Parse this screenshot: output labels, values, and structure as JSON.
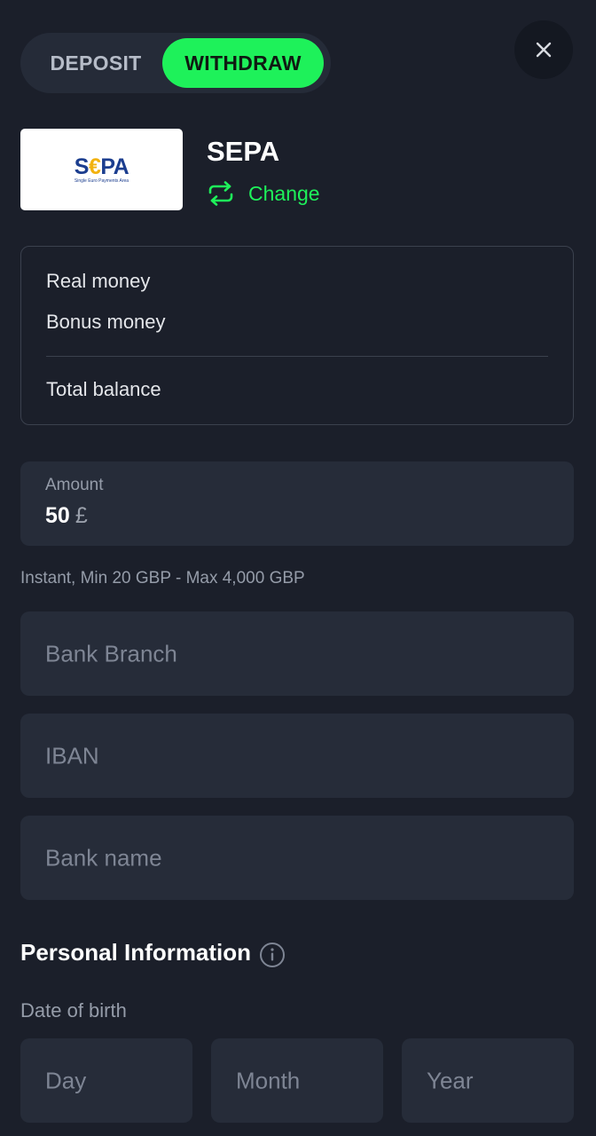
{
  "tabs": {
    "deposit": "DEPOSIT",
    "withdraw": "WITHDRAW"
  },
  "payment_method": {
    "logo_text_s": "S",
    "logo_text_euro": "€",
    "logo_text_pa": "PA",
    "logo_subtitle": "Single Euro Payments Area",
    "name": "SEPA",
    "change_label": "Change"
  },
  "balance": {
    "real_money": "Real money",
    "bonus_money": "Bonus money",
    "total_balance": "Total balance"
  },
  "amount": {
    "label": "Amount",
    "value": "50",
    "currency": "£"
  },
  "limits_text": "Instant, Min 20 GBP - Max 4,000 GBP",
  "fields": {
    "bank_branch": "Bank Branch",
    "iban": "IBAN",
    "bank_name": "Bank name"
  },
  "personal_info": {
    "title": "Personal Information",
    "dob_label": "Date of birth",
    "day": "Day",
    "month": "Month",
    "year": "Year"
  },
  "colors": {
    "background": "#1b1f2a",
    "accent": "#1ef15a",
    "field_bg": "#262c39",
    "muted_text": "#959ca9"
  },
  "icons": {
    "close": "close-icon",
    "change": "swap-arrows-icon",
    "info": "info-icon"
  }
}
